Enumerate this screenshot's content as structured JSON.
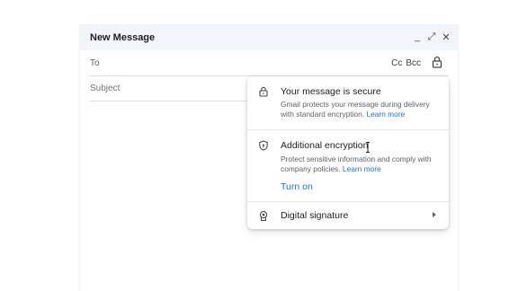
{
  "compose": {
    "title": "New Message",
    "header_icons": [
      "minimize-icon",
      "expand-icon",
      "close-icon"
    ],
    "minimize_glyph": "_",
    "expand_glyph": "⤢",
    "close_glyph": "✕",
    "to_label": "To",
    "to_value": "",
    "cc_label": "Cc",
    "bcc_label": "Bcc",
    "subject_placeholder": "Subject",
    "subject_value": ""
  },
  "security_popover": {
    "secure": {
      "title": "Your message is secure",
      "description": "Gmail protects your message during delivery with standard encryption.",
      "link": "Learn more"
    },
    "encryption": {
      "title": "Additional encryption",
      "description": "Protect sensitive information and comply with company policies.",
      "link": "Learn more",
      "action": "Turn on"
    },
    "signature": {
      "title": "Digital signature"
    }
  },
  "colors": {
    "header_bg": "#f2f6fc",
    "link": "#1a73e8",
    "text": "#202124",
    "secondary_text": "#5f6368"
  }
}
